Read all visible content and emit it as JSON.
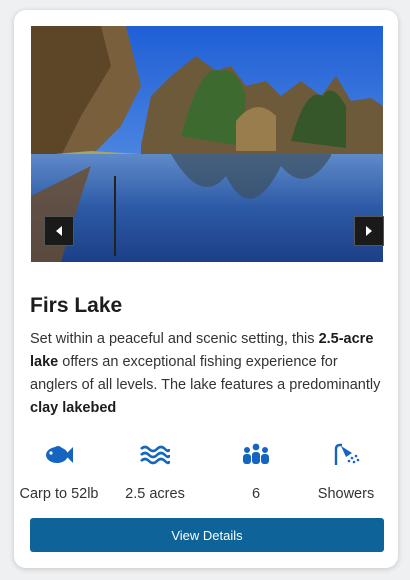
{
  "lake": {
    "name": "Firs Lake",
    "description_parts": [
      "Set within a peaceful and scenic setting, this ",
      "2.5-acre lake",
      " offers an exceptional fishing experience for anglers of all levels. The lake features a predominantly ",
      "clay lakebed"
    ]
  },
  "features": [
    {
      "icon": "fish-icon",
      "label": "Carp to 52lb"
    },
    {
      "icon": "waves-icon",
      "label": "2.5 acres"
    },
    {
      "icon": "people-icon",
      "label": "6"
    },
    {
      "icon": "shower-icon",
      "label": "Showers"
    }
  ],
  "actions": {
    "view_details": "View Details"
  },
  "colors": {
    "accent": "#1565c0",
    "button": "#0e6399"
  }
}
